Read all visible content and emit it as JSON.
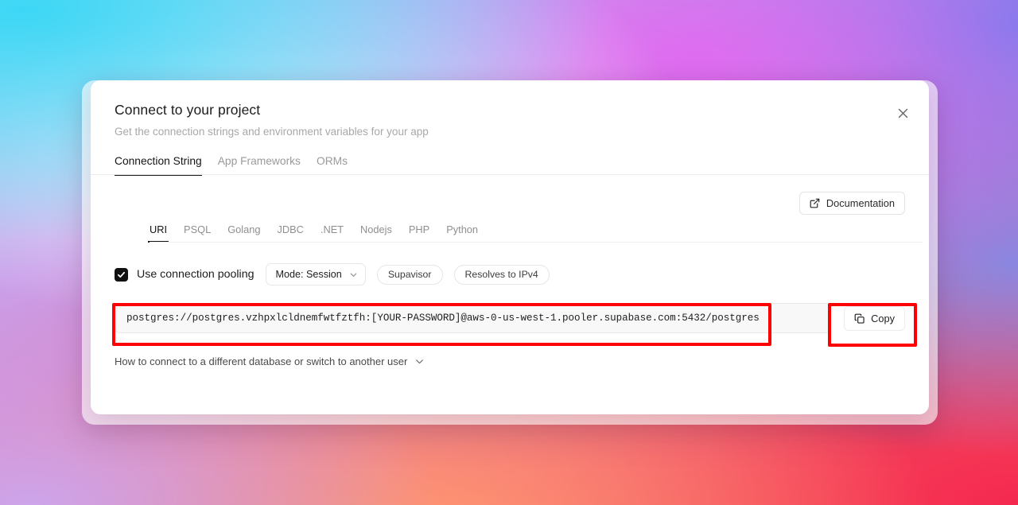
{
  "dialog": {
    "title": "Connect to your project",
    "subtitle": "Get the connection strings and environment variables for your app",
    "close_label": "×"
  },
  "primary_tabs": [
    {
      "label": "Connection String",
      "active": true
    },
    {
      "label": "App Frameworks",
      "active": false
    },
    {
      "label": "ORMs",
      "active": false
    }
  ],
  "documentation_button": {
    "label": "Documentation",
    "icon": "external-link-icon"
  },
  "sub_tabs": [
    {
      "label": "URI",
      "active": true
    },
    {
      "label": "PSQL",
      "active": false
    },
    {
      "label": "Golang",
      "active": false
    },
    {
      "label": "JDBC",
      "active": false
    },
    {
      "label": ".NET",
      "active": false
    },
    {
      "label": "Nodejs",
      "active": false
    },
    {
      "label": "PHP",
      "active": false
    },
    {
      "label": "Python",
      "active": false
    }
  ],
  "pooling": {
    "checkbox_checked": true,
    "label": "Use connection pooling",
    "mode_select": {
      "label": "Mode: Session",
      "icon": "chevron-down-icon"
    },
    "badges": [
      "Supavisor",
      "Resolves to IPv4"
    ]
  },
  "connection_string": {
    "value": "postgres://postgres.vzhpxlcldnemfwtfztfh:[YOUR-PASSWORD]@aws-0-us-west-1.pooler.supabase.com:5432/postgres",
    "copy_button": {
      "label": "Copy",
      "icon": "copy-icon"
    }
  },
  "footer": {
    "label": "How to connect to a different database or switch to another user",
    "icon": "chevron-down-icon"
  },
  "annotations": {
    "color": "#ff0000",
    "boxes": [
      "connection-string-field",
      "copy-button"
    ]
  }
}
